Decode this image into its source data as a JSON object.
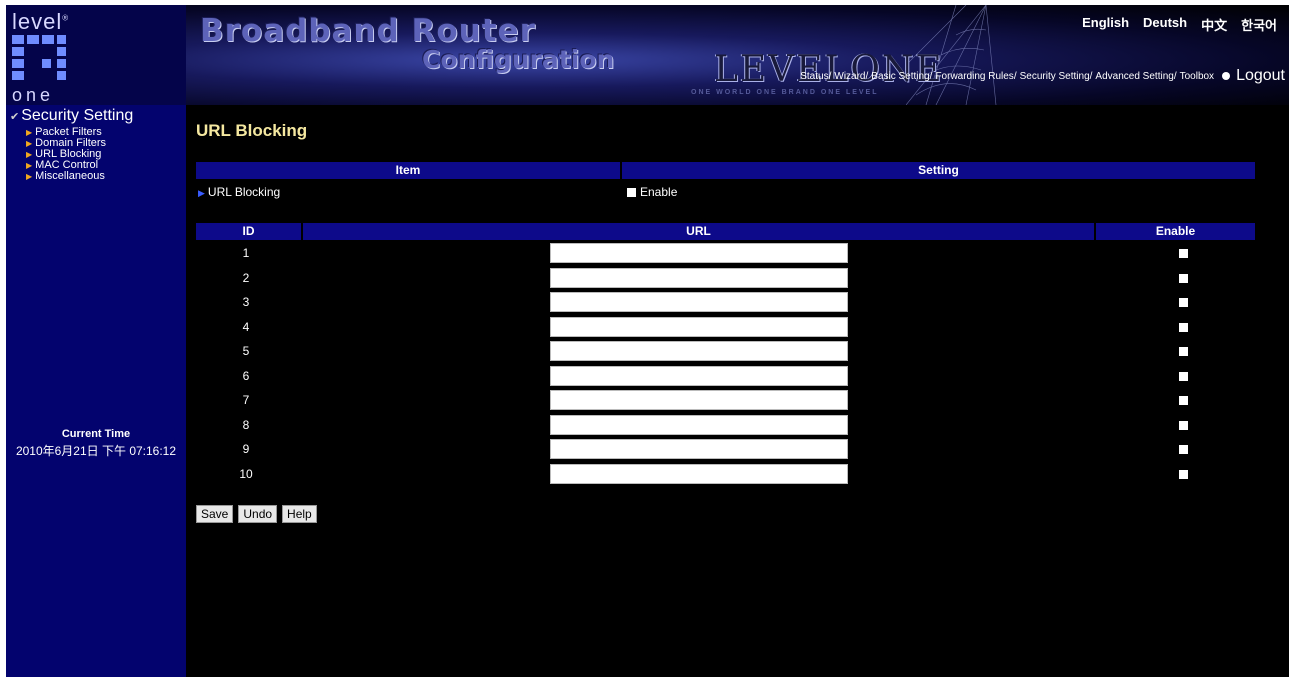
{
  "logo": {
    "top": "level",
    "mark": "®",
    "bottom": "one"
  },
  "banner": {
    "title_line1": "Broadband Router",
    "title_line2": "Configuration",
    "brand": "LEVELONE",
    "slogan": "ONE WORLD ONE BRAND ONE LEVEL"
  },
  "languages": [
    "English",
    "Deutsh",
    "中文",
    "한국어"
  ],
  "topnav": {
    "items": [
      "Status",
      "Wizard",
      "Basic Setting",
      "Forwarding Rules",
      "Security Setting",
      "Advanced Setting",
      "Toolbox"
    ],
    "logout": "Logout"
  },
  "sidebar": {
    "heading": "Security Setting",
    "items": [
      "Packet Filters",
      "Domain Filters",
      "URL Blocking",
      "MAC Control",
      "Miscellaneous"
    ],
    "current_time_label": "Current Time",
    "current_time_value": "2010年6月21日 下午 07:16:12"
  },
  "main": {
    "title": "URL Blocking",
    "item_header": "Item",
    "setting_header": "Setting",
    "item_label": "URL Blocking",
    "enable_label": "Enable",
    "table_headers": {
      "id": "ID",
      "url": "URL",
      "enable": "Enable"
    },
    "rows": [
      {
        "id": "1",
        "url": ""
      },
      {
        "id": "2",
        "url": ""
      },
      {
        "id": "3",
        "url": ""
      },
      {
        "id": "4",
        "url": ""
      },
      {
        "id": "5",
        "url": ""
      },
      {
        "id": "6",
        "url": ""
      },
      {
        "id": "7",
        "url": ""
      },
      {
        "id": "8",
        "url": ""
      },
      {
        "id": "9",
        "url": ""
      },
      {
        "id": "10",
        "url": ""
      }
    ],
    "buttons": {
      "save": "Save",
      "undo": "Undo",
      "help": "Help"
    }
  },
  "colors": {
    "sidebar_bg": "#03036e",
    "header_bar": "#0d0a8a",
    "title_color": "#f5e8a0",
    "bullet": "#f0a820"
  }
}
